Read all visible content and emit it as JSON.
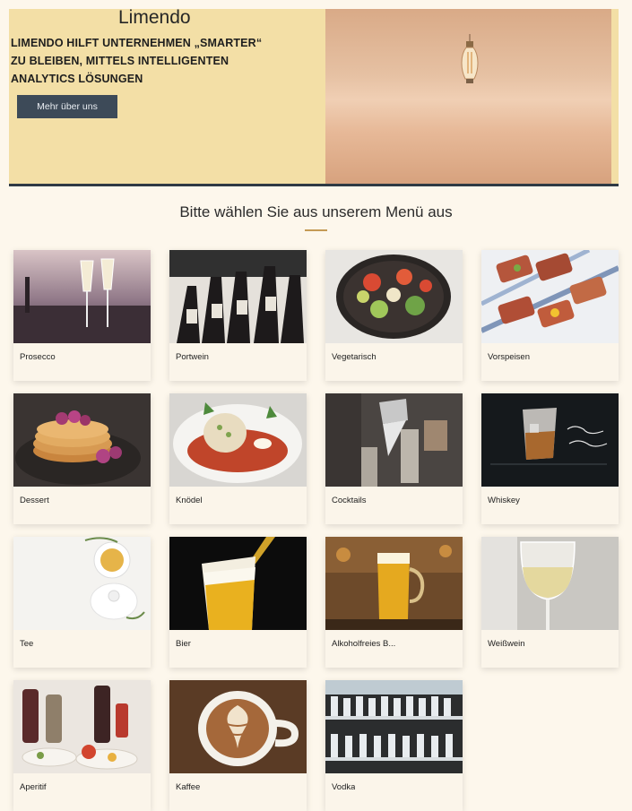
{
  "hero": {
    "brand": "Limendo",
    "tagline_lines": [
      "LIMENDO HILFT UNTERNEHMEN „SMARTER“",
      "ZU BLEIBEN, MITTELS INTELLIGENTEN",
      "ANALYTICS LÖSUNGEN"
    ],
    "about_button": "Mehr über uns"
  },
  "menu": {
    "title": "Bitte wählen Sie aus unserem Menü aus",
    "items": [
      {
        "label": "Prosecco",
        "image": "prosecco-photo"
      },
      {
        "label": "Portwein",
        "image": "portwein-photo"
      },
      {
        "label": "Vegetarisch",
        "image": "vegetarisch-photo"
      },
      {
        "label": "Vorspeisen",
        "image": "vorspeisen-photo"
      },
      {
        "label": "Dessert",
        "image": "dessert-photo"
      },
      {
        "label": "Knödel",
        "image": "knoedel-photo"
      },
      {
        "label": "Cocktails",
        "image": "cocktails-photo"
      },
      {
        "label": "Whiskey",
        "image": "whiskey-photo"
      },
      {
        "label": "Tee",
        "image": "tee-photo"
      },
      {
        "label": "Bier",
        "image": "bier-photo"
      },
      {
        "label": "Alkoholfreies B...",
        "image": "alkoholfrei-photo"
      },
      {
        "label": "Weißwein",
        "image": "weisswein-photo"
      },
      {
        "label": "Aperitif",
        "image": "aperitif-photo"
      },
      {
        "label": "Kaffee",
        "image": "kaffee-photo"
      },
      {
        "label": "Vodka",
        "image": "vodka-photo"
      }
    ]
  },
  "colors": {
    "page_background": "#fdf7ec",
    "hero_background": "#f3dfa6",
    "button": "#3d4a58",
    "accent_rule": "#c59a55"
  }
}
